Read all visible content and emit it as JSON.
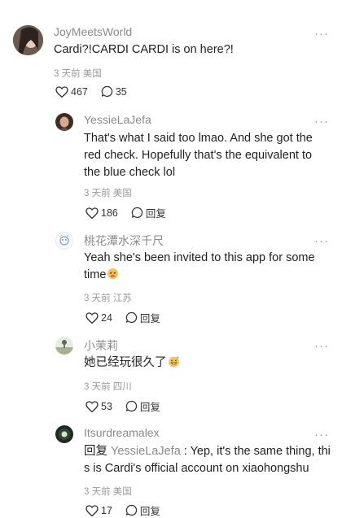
{
  "comments": [
    {
      "author": "JoyMeetsWorld",
      "text": "Cardi?!CARDI CARDI is on here?!",
      "time": "3 天前",
      "location": "美国",
      "likes": "467",
      "replies": "35"
    },
    {
      "author": "YessieLaJefa",
      "text": "That's what I said too lmao. And she got the red check. Hopefully that's the equivalent to the blue check lol",
      "time": "3 天前",
      "location": "美国",
      "likes": "186",
      "reply_label": "回复"
    },
    {
      "author": "桃花潭水深千尺",
      "text": "Yeah she's been invited to this app for some time",
      "time": "3 天前",
      "location": "江苏",
      "likes": "24",
      "reply_label": "回复"
    },
    {
      "author": "小茉莉",
      "text": "她已经玩很久了",
      "time": "3 天前",
      "location": "四川",
      "likes": "53",
      "reply_label": "回复"
    },
    {
      "author": "Itsurdreamalex",
      "reply_prefix": "回复",
      "mention": "YessieLaJefa",
      "text": " : Yep, it's the same thing, this is Cardi's official account on xiaohongshu",
      "time": "3 天前",
      "location": "美国",
      "likes": "17",
      "reply_label": "回复"
    }
  ],
  "more_label": "···",
  "colors": {
    "name": "#8a8a8a",
    "text": "#222222",
    "meta": "#999999"
  },
  "icons": [
    "heart-icon",
    "comment-bubble-icon",
    "more-icon",
    "sad-face-emoji-icon",
    "grin-face-emoji-icon"
  ]
}
